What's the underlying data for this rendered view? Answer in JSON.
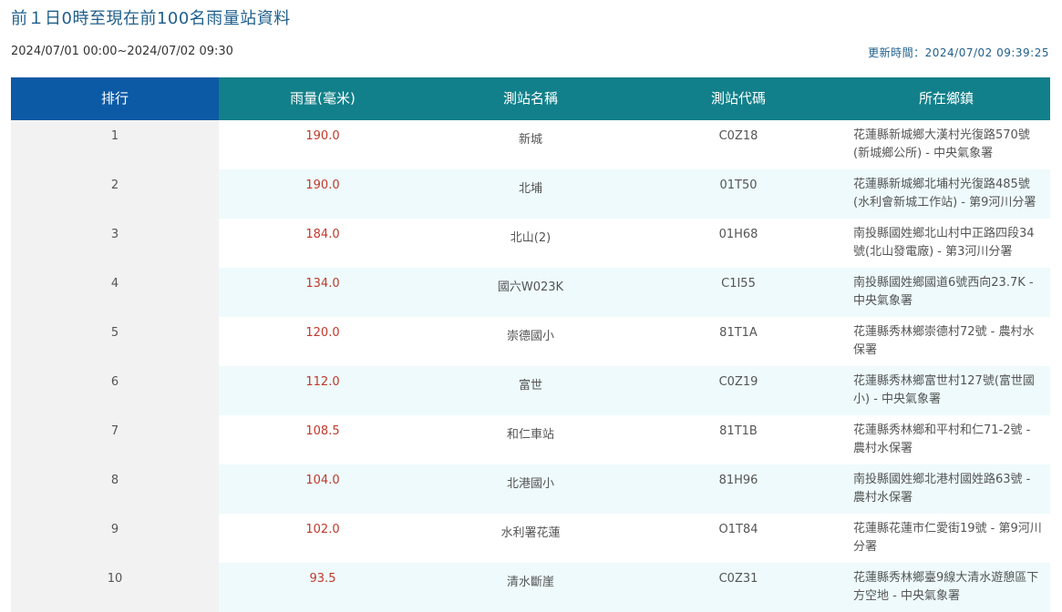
{
  "page": {
    "title": "前１日0時至現在前100名雨量站資料",
    "time_range": "2024/07/01 00:00~2024/07/02 09:30",
    "updated": "更新時間：2024/07/02 09:39:25"
  },
  "table": {
    "headers": {
      "rank": "排行",
      "rainfall": "雨量(毫米)",
      "station_name": "測站名稱",
      "station_id": "測站代碼",
      "location": "所在鄉鎮"
    },
    "rows": [
      {
        "rank": "1",
        "rainfall": "190.0",
        "station_name": "新城",
        "station_id": "C0Z18",
        "location": "花蓮縣新城鄉大漢村光復路570號(新城鄉公所) - 中央氣象署"
      },
      {
        "rank": "2",
        "rainfall": "190.0",
        "station_name": "北埔",
        "station_id": "01T50",
        "location": "花蓮縣新城鄉北埔村光復路485號(水利會新城工作站) - 第9河川分署"
      },
      {
        "rank": "3",
        "rainfall": "184.0",
        "station_name": "北山(2)",
        "station_id": "01H68",
        "location": "南投縣國姓鄉北山村中正路四段34號(北山發電廠) - 第3河川分署"
      },
      {
        "rank": "4",
        "rainfall": "134.0",
        "station_name": "國六W023K",
        "station_id": "C1I55",
        "location": "南投縣國姓鄉國道6號西向23.7K - 中央氣象署"
      },
      {
        "rank": "5",
        "rainfall": "120.0",
        "station_name": "崇德國小",
        "station_id": "81T1A",
        "location": "花蓮縣秀林鄉崇德村72號 - 農村水保署"
      },
      {
        "rank": "6",
        "rainfall": "112.0",
        "station_name": "富世",
        "station_id": "C0Z19",
        "location": "花蓮縣秀林鄉富世村127號(富世國小) - 中央氣象署"
      },
      {
        "rank": "7",
        "rainfall": "108.5",
        "station_name": "和仁車站",
        "station_id": "81T1B",
        "location": "花蓮縣秀林鄉和平村和仁71-2號 - 農村水保署"
      },
      {
        "rank": "8",
        "rainfall": "104.0",
        "station_name": "北港國小",
        "station_id": "81H96",
        "location": "南投縣國姓鄉北港村國姓路63號 - 農村水保署"
      },
      {
        "rank": "9",
        "rainfall": "102.0",
        "station_name": "水利署花蓮",
        "station_id": "O1T84",
        "location": "花蓮縣花蓮市仁愛街19號 - 第9河川分署"
      },
      {
        "rank": "10",
        "rainfall": "93.5",
        "station_name": "清水斷崖",
        "station_id": "C0Z31",
        "location": "花蓮縣秀林鄉臺9線大清水遊憩區下方空地 - 中央氣象署"
      }
    ]
  },
  "colors": {
    "title": "#1f5f8b",
    "header_teal": "#12808a",
    "header_rank": "#0c5aa6",
    "rainfall_value": "#c0392b",
    "row_alt": "#eefafb",
    "rank_col_bg": "#f2f2f2"
  }
}
